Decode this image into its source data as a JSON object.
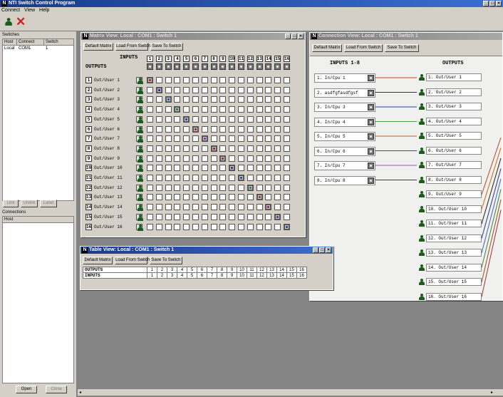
{
  "app": {
    "title": "NTI Switch Control Program"
  },
  "menu": [
    "Connect",
    "View",
    "Help"
  ],
  "switches_panel": {
    "title": "Switches",
    "columns": [
      "Host",
      "Connect",
      "Switch"
    ],
    "row": [
      "Local",
      "COM1",
      "1"
    ],
    "buttons": [
      "Link",
      "Unlink",
      "Label"
    ]
  },
  "connections_panel": {
    "title": "Connections",
    "columns": [
      "Host"
    ],
    "buttons": [
      "Open",
      "Close"
    ]
  },
  "common_buttons": {
    "default": "Default Matrix",
    "load": "Load From Switch",
    "save": "Save To Switch"
  },
  "matrix_window": {
    "title": "Matrix View: Local : COM1 : Switch 1",
    "inputs_label": "INPUTS",
    "outputs_label": "OUTPUTS",
    "input_numbers": [
      "1",
      "2",
      "3",
      "4",
      "5",
      "6",
      "7",
      "8",
      "9",
      "10",
      "11",
      "12",
      "13",
      "14",
      "15",
      "16"
    ],
    "outputs": [
      "Out/User 1",
      "Out/User 2",
      "Out/User 3",
      "Out/User 4",
      "Out/User 5",
      "Out/User 6",
      "Out/User 7",
      "Out/User 8",
      "Out/User 9",
      "Out/User 10",
      "Out/User 11",
      "Out/User 12",
      "Out/User 13",
      "Out/User 14",
      "Out/User 15",
      "Out/User 16"
    ],
    "connections": [
      1,
      2,
      3,
      4,
      5,
      6,
      7,
      8,
      9,
      10,
      11,
      12,
      13,
      14,
      15,
      16
    ]
  },
  "connect_window": {
    "title": "Connection View: Local : COM1 : Switch 1",
    "inputs_header": "INPUTS 1-8",
    "outputs_header": "OUTPUTS",
    "inputs": [
      "1. In/Cpu 1",
      "2. asdfgfasdfgsf",
      "3. In/Cpu 3",
      "4. In/Cpu 4",
      "5. In/Cpu 5",
      "6. In/Cpu 6",
      "7. In/Cpu 7",
      "8. In/Cpu 8"
    ],
    "outputs": [
      "1. Out/User 1",
      "2. Out/User 2",
      "3. Out/User 3",
      "4. Out/User 4",
      "5. Out/User 5",
      "6. Out/User 6",
      "7. Out/User 7",
      "8. Out/User 8",
      "9. Out/User 9",
      "10. Out/User 10",
      "11. Out/User 11",
      "12. Out/User 12",
      "13. Out/User 13",
      "14. Out/User 14",
      "15. Out/User 15",
      "16. Out/User 16"
    ],
    "line_colors": [
      "#d04020",
      "#203080",
      "#2040a0",
      "#40a040",
      "#c06020",
      "#c02020",
      "#a050c0",
      "#404040"
    ]
  },
  "table_window": {
    "title": "Table View: Local : COM1 : Switch 1",
    "row_labels": [
      "OUTPUTS",
      "INPUTS"
    ],
    "outputs": [
      "1",
      "2",
      "3",
      "4",
      "5",
      "6",
      "7",
      "8",
      "9",
      "10",
      "11",
      "12",
      "13",
      "14",
      "15",
      "16"
    ],
    "inputs": [
      "1",
      "2",
      "3",
      "4",
      "5",
      "6",
      "7",
      "8",
      "9",
      "10",
      "11",
      "12",
      "13",
      "14",
      "15",
      "16"
    ]
  },
  "colors": {
    "titlebar": "#1a3a8a",
    "face": "#d4d0c8",
    "desktop": "#848484"
  }
}
